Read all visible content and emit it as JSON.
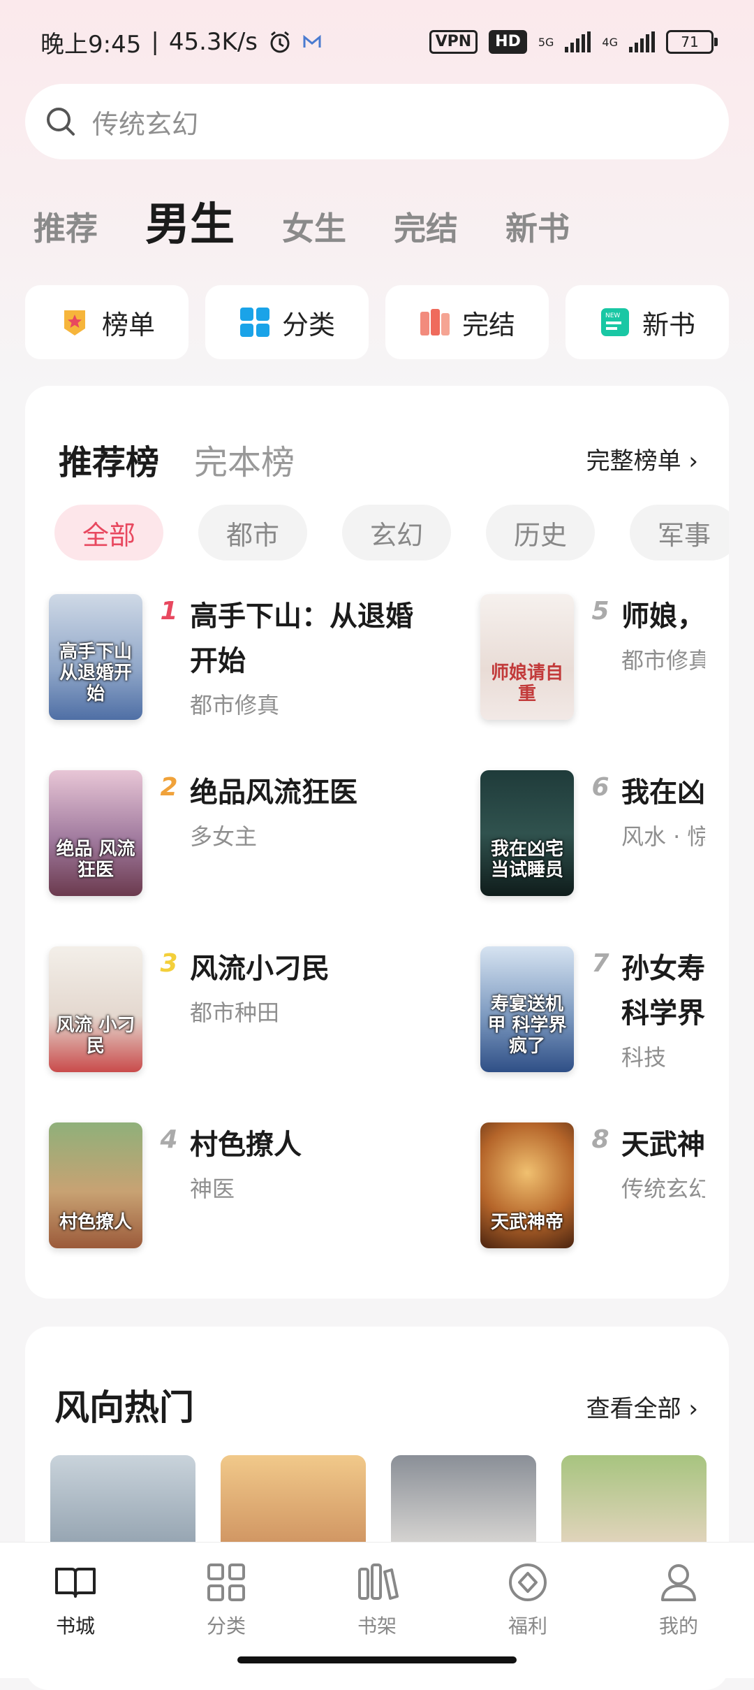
{
  "status": {
    "time": "晚上9:45",
    "speed": "45.3K/s",
    "vpn": "VPN",
    "hd": "HD",
    "net1": "5G",
    "net2": "4G",
    "battery": "71"
  },
  "search": {
    "placeholder": "传统玄幻"
  },
  "channels": [
    "推荐",
    "男生",
    "女生",
    "完结",
    "新书"
  ],
  "quick": [
    "榜单",
    "分类",
    "完结",
    "新书"
  ],
  "rank": {
    "tabs": [
      "推荐榜",
      "完本榜"
    ],
    "more": "完整榜单 ›",
    "filters": [
      "全部",
      "都市",
      "玄幻",
      "历史",
      "军事"
    ],
    "books": [
      {
        "num": "1",
        "title": "高手下山：从退婚开始",
        "tag": "都市修真",
        "cover_text": "高手下山 从退婚开始"
      },
      {
        "num": "2",
        "title": "绝品风流狂医",
        "tag": "多女主",
        "cover_text": "绝品 风流狂医"
      },
      {
        "num": "3",
        "title": "风流小刁民",
        "tag": "都市种田",
        "cover_text": "风流 小刁民"
      },
      {
        "num": "4",
        "title": "村色撩人",
        "tag": "神医",
        "cover_text": "村色撩人"
      },
      {
        "num": "5",
        "title": "师娘，",
        "tag": "都市修真",
        "cover_text": "师娘请自重"
      },
      {
        "num": "6",
        "title": "我在凶",
        "tag": "风水 · 惊",
        "cover_text": "我在凶宅 当试睡员"
      },
      {
        "num": "7",
        "title": "孙女寿",
        "title2": "科学界",
        "tag": "科技",
        "cover_text": "寿宴送机甲 科学界疯了"
      },
      {
        "num": "8",
        "title": "天武神",
        "tag": "传统玄幻",
        "cover_text": "天武神帝"
      }
    ]
  },
  "hot": {
    "title": "风向热门",
    "more": "查看全部 ›"
  },
  "nav": [
    "书城",
    "分类",
    "书架",
    "福利",
    "我的"
  ],
  "colors": {
    "accent": "#e8485f",
    "rank1": "#e8485f",
    "rank2": "#f0a23a",
    "rank3": "#f3cf3a",
    "rank_other": "#aaaaaa"
  }
}
